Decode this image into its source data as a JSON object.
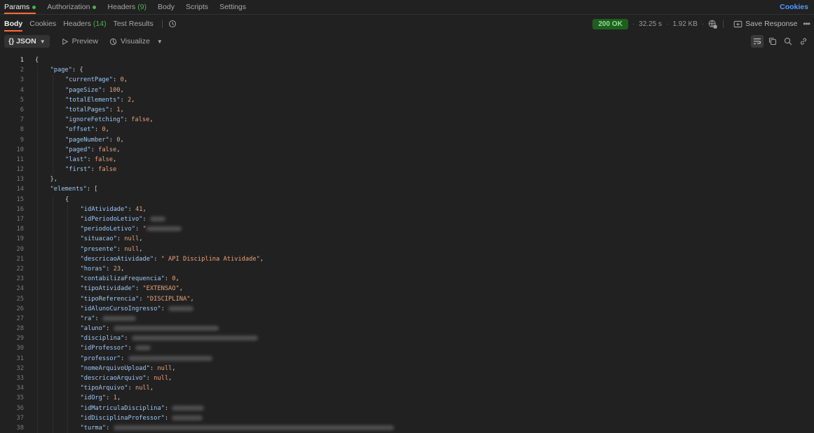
{
  "request_tabs": [
    {
      "label": "Params",
      "dot": true,
      "active": true
    },
    {
      "label": "Authorization",
      "dot": true
    },
    {
      "label": "Headers",
      "count": "(9)"
    },
    {
      "label": "Body"
    },
    {
      "label": "Scripts"
    },
    {
      "label": "Settings"
    }
  ],
  "cookies_link": "Cookies",
  "response_tabs": {
    "body": "Body",
    "cookies": "Cookies",
    "headers": "Headers",
    "headers_count": "(14)",
    "test_results": "Test Results"
  },
  "response_meta": {
    "status": "200 OK",
    "time": "32.25 s",
    "size": "1.92 KB",
    "save_response": "Save Response",
    "more": "•••"
  },
  "format_bar": {
    "format": "{} JSON",
    "preview": "Preview",
    "visualize": "Visualize"
  },
  "code_lines": [
    {
      "n": "1",
      "indent": 0,
      "parts": [
        [
          "p",
          "{"
        ]
      ]
    },
    {
      "n": "2",
      "indent": 1,
      "parts": [
        [
          "k",
          "\"page\""
        ],
        [
          "p",
          ": {"
        ]
      ]
    },
    {
      "n": "3",
      "indent": 2,
      "parts": [
        [
          "k",
          "\"currentPage\""
        ],
        [
          "p",
          ": "
        ],
        [
          "n",
          "0"
        ],
        [
          "p",
          ","
        ]
      ]
    },
    {
      "n": "4",
      "indent": 2,
      "parts": [
        [
          "k",
          "\"pageSize\""
        ],
        [
          "p",
          ": "
        ],
        [
          "n",
          "100"
        ],
        [
          "p",
          ","
        ]
      ]
    },
    {
      "n": "5",
      "indent": 2,
      "parts": [
        [
          "k",
          "\"totalElements\""
        ],
        [
          "p",
          ": "
        ],
        [
          "n",
          "2"
        ],
        [
          "p",
          ","
        ]
      ]
    },
    {
      "n": "6",
      "indent": 2,
      "parts": [
        [
          "k",
          "\"totalPages\""
        ],
        [
          "p",
          ": "
        ],
        [
          "n",
          "1"
        ],
        [
          "p",
          ","
        ]
      ]
    },
    {
      "n": "7",
      "indent": 2,
      "parts": [
        [
          "k",
          "\"ignoreFetching\""
        ],
        [
          "p",
          ": "
        ],
        [
          "b",
          "false"
        ],
        [
          "p",
          ","
        ]
      ]
    },
    {
      "n": "8",
      "indent": 2,
      "parts": [
        [
          "k",
          "\"offset\""
        ],
        [
          "p",
          ": "
        ],
        [
          "n",
          "0"
        ],
        [
          "p",
          ","
        ]
      ]
    },
    {
      "n": "9",
      "indent": 2,
      "parts": [
        [
          "k",
          "\"pageNumber\""
        ],
        [
          "p",
          ": "
        ],
        [
          "n",
          "0"
        ],
        [
          "p",
          ","
        ]
      ]
    },
    {
      "n": "10",
      "indent": 2,
      "parts": [
        [
          "k",
          "\"paged\""
        ],
        [
          "p",
          ": "
        ],
        [
          "b",
          "false"
        ],
        [
          "p",
          ","
        ]
      ]
    },
    {
      "n": "11",
      "indent": 2,
      "parts": [
        [
          "k",
          "\"last\""
        ],
        [
          "p",
          ": "
        ],
        [
          "b",
          "false"
        ],
        [
          "p",
          ","
        ]
      ]
    },
    {
      "n": "12",
      "indent": 2,
      "parts": [
        [
          "k",
          "\"first\""
        ],
        [
          "p",
          ": "
        ],
        [
          "b",
          "false"
        ]
      ]
    },
    {
      "n": "13",
      "indent": 1,
      "parts": [
        [
          "p",
          "},"
        ]
      ]
    },
    {
      "n": "14",
      "indent": 1,
      "parts": [
        [
          "k",
          "\"elements\""
        ],
        [
          "p",
          ": ["
        ]
      ]
    },
    {
      "n": "15",
      "indent": 2,
      "parts": [
        [
          "p",
          "{"
        ]
      ]
    },
    {
      "n": "16",
      "indent": 3,
      "parts": [
        [
          "k",
          "\"idAtividade\""
        ],
        [
          "p",
          ": "
        ],
        [
          "n",
          "41"
        ],
        [
          "p",
          ","
        ]
      ]
    },
    {
      "n": "17",
      "indent": 3,
      "parts": [
        [
          "k",
          "\"idPeriodoLetivo\""
        ],
        [
          "p",
          ": "
        ]
      ],
      "blur": 22
    },
    {
      "n": "18",
      "indent": 3,
      "parts": [
        [
          "k",
          "\"periodoLetivo\""
        ],
        [
          "p",
          ": "
        ],
        [
          "s",
          "\""
        ]
      ],
      "blur": 50
    },
    {
      "n": "19",
      "indent": 3,
      "parts": [
        [
          "k",
          "\"situacao\""
        ],
        [
          "p",
          ": "
        ],
        [
          "b",
          "null"
        ],
        [
          "p",
          ","
        ]
      ]
    },
    {
      "n": "20",
      "indent": 3,
      "parts": [
        [
          "k",
          "\"presente\""
        ],
        [
          "p",
          ": "
        ],
        [
          "b",
          "null"
        ],
        [
          "p",
          ","
        ]
      ]
    },
    {
      "n": "21",
      "indent": 3,
      "parts": [
        [
          "k",
          "\"descricaoAtividade\""
        ],
        [
          "p",
          ": "
        ],
        [
          "s",
          "\" API Disciplina Atividade\""
        ],
        [
          "p",
          ","
        ]
      ]
    },
    {
      "n": "22",
      "indent": 3,
      "parts": [
        [
          "k",
          "\"horas\""
        ],
        [
          "p",
          ": "
        ],
        [
          "n",
          "23"
        ],
        [
          "p",
          ","
        ]
      ]
    },
    {
      "n": "23",
      "indent": 3,
      "parts": [
        [
          "k",
          "\"contabilizaFrequencia\""
        ],
        [
          "p",
          ": "
        ],
        [
          "n",
          "0"
        ],
        [
          "p",
          ","
        ]
      ]
    },
    {
      "n": "24",
      "indent": 3,
      "parts": [
        [
          "k",
          "\"tipoAtividade\""
        ],
        [
          "p",
          ": "
        ],
        [
          "s",
          "\"EXTENSAO\""
        ],
        [
          "p",
          ","
        ]
      ]
    },
    {
      "n": "25",
      "indent": 3,
      "parts": [
        [
          "k",
          "\"tipoReferencia\""
        ],
        [
          "p",
          ": "
        ],
        [
          "s",
          "\"DISCIPLINA\""
        ],
        [
          "p",
          ","
        ]
      ]
    },
    {
      "n": "26",
      "indent": 3,
      "parts": [
        [
          "k",
          "\"idAlunoCursoIngresso\""
        ],
        [
          "p",
          ": "
        ]
      ],
      "blur": 36
    },
    {
      "n": "27",
      "indent": 3,
      "parts": [
        [
          "k",
          "\"ra\""
        ],
        [
          "p",
          ": "
        ]
      ],
      "blur": 48
    },
    {
      "n": "28",
      "indent": 3,
      "parts": [
        [
          "k",
          "\"aluno\""
        ],
        [
          "p",
          ": "
        ]
      ],
      "blur": 150
    },
    {
      "n": "29",
      "indent": 3,
      "parts": [
        [
          "k",
          "\"disciplina\""
        ],
        [
          "p",
          ": "
        ]
      ],
      "blur": 180
    },
    {
      "n": "30",
      "indent": 3,
      "parts": [
        [
          "k",
          "\"idProfessor\""
        ],
        [
          "p",
          ": "
        ]
      ],
      "blur": 22
    },
    {
      "n": "31",
      "indent": 3,
      "parts": [
        [
          "k",
          "\"professor\""
        ],
        [
          "p",
          ": "
        ]
      ],
      "blur": 120
    },
    {
      "n": "32",
      "indent": 3,
      "parts": [
        [
          "k",
          "\"nomeArquivoUpload\""
        ],
        [
          "p",
          ": "
        ],
        [
          "b",
          "null"
        ],
        [
          "p",
          ","
        ]
      ]
    },
    {
      "n": "33",
      "indent": 3,
      "parts": [
        [
          "k",
          "\"descricaoArquivo\""
        ],
        [
          "p",
          ": "
        ],
        [
          "b",
          "null"
        ],
        [
          "p",
          ","
        ]
      ]
    },
    {
      "n": "34",
      "indent": 3,
      "parts": [
        [
          "k",
          "\"tipoArquivo\""
        ],
        [
          "p",
          ": "
        ],
        [
          "b",
          "null"
        ],
        [
          "p",
          ","
        ]
      ]
    },
    {
      "n": "35",
      "indent": 3,
      "parts": [
        [
          "k",
          "\"idOrg\""
        ],
        [
          "p",
          ": "
        ],
        [
          "n",
          "1"
        ],
        [
          "p",
          ","
        ]
      ]
    },
    {
      "n": "36",
      "indent": 3,
      "parts": [
        [
          "k",
          "\"idMatriculaDisciplina\""
        ],
        [
          "p",
          ": "
        ]
      ],
      "blur": 46
    },
    {
      "n": "37",
      "indent": 3,
      "parts": [
        [
          "k",
          "\"idDisciplinaProfessor\""
        ],
        [
          "p",
          ": "
        ]
      ],
      "blur": 44
    },
    {
      "n": "38",
      "indent": 3,
      "parts": [
        [
          "k",
          "\"turma\""
        ],
        [
          "p",
          ": "
        ]
      ],
      "blur": 400
    }
  ]
}
